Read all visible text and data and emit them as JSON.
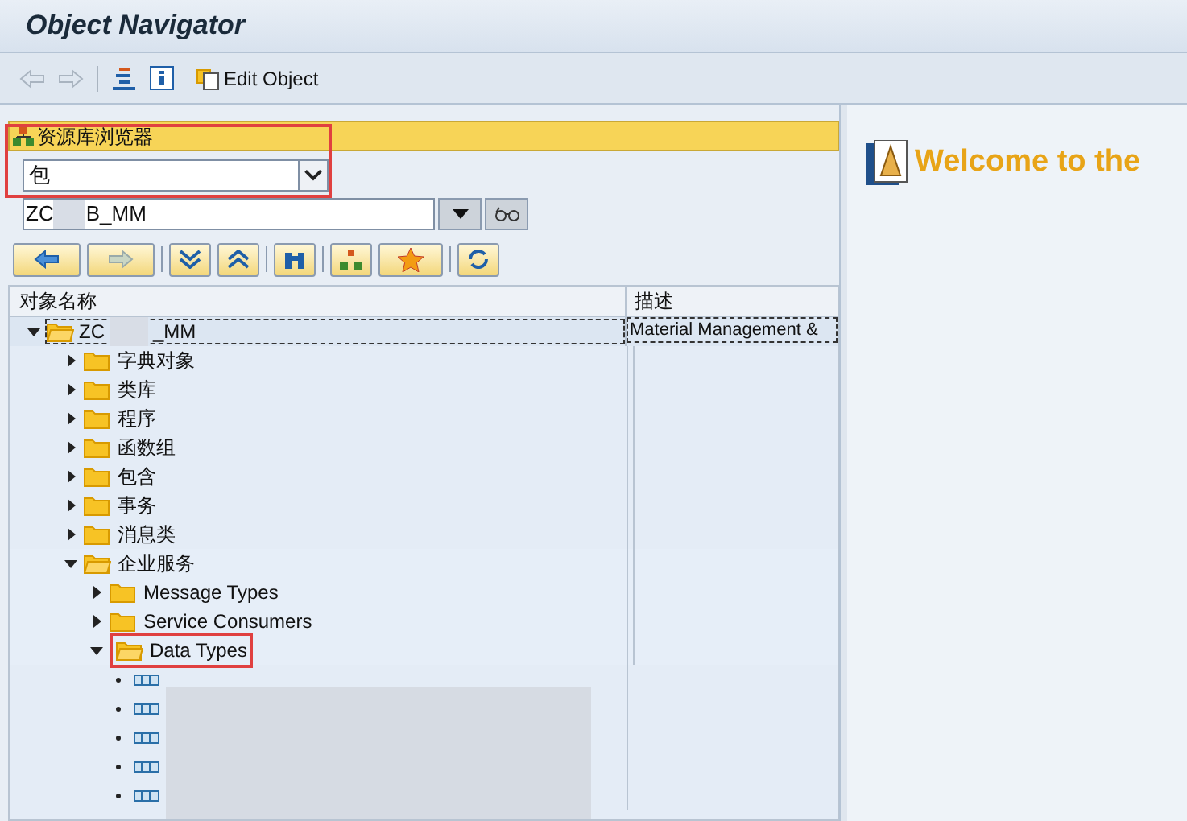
{
  "window": {
    "title": "Object Navigator"
  },
  "toolbar": {
    "edit_button": "Edit Object"
  },
  "browser": {
    "title": "资源库浏览器",
    "object_type": "包",
    "object_name_prefix": "ZC",
    "object_name_suffix": "B_MM"
  },
  "tree": {
    "columns": [
      "对象名称",
      "描述"
    ],
    "root": {
      "name_prefix": "ZC",
      "name_suffix": "_MM",
      "description": "Material Management &",
      "expanded": true,
      "children": [
        {
          "name": "字典对象",
          "expanded": false
        },
        {
          "name": "类库",
          "expanded": false
        },
        {
          "name": "程序",
          "expanded": false
        },
        {
          "name": "函数组",
          "expanded": false
        },
        {
          "name": "包含",
          "expanded": false
        },
        {
          "name": "事务",
          "expanded": false
        },
        {
          "name": "消息类",
          "expanded": false
        },
        {
          "name": "企业服务",
          "expanded": true,
          "children": [
            {
              "name": "Message Types",
              "expanded": false
            },
            {
              "name": "Service Consumers",
              "expanded": false
            },
            {
              "name": "Data Types",
              "expanded": true,
              "children": [
                {
                  "kind": "data-type"
                },
                {
                  "kind": "data-type"
                },
                {
                  "kind": "data-type"
                },
                {
                  "kind": "data-type"
                },
                {
                  "kind": "data-type"
                }
              ]
            }
          ]
        }
      ]
    }
  },
  "welcome": {
    "title": "Welcome to the"
  }
}
